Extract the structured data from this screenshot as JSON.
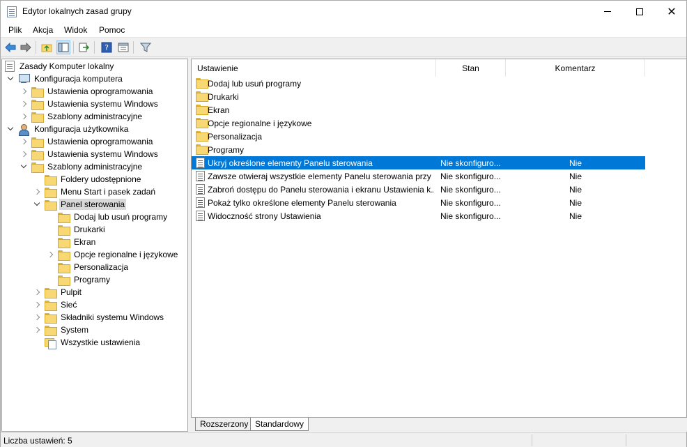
{
  "window": {
    "title": "Edytor lokalnych zasad grupy"
  },
  "menubar": {
    "items": [
      {
        "label": "Plik"
      },
      {
        "label": "Akcja"
      },
      {
        "label": "Widok"
      },
      {
        "label": "Pomoc"
      }
    ]
  },
  "toolbar": {
    "buttons": [
      "back-arrow-icon",
      "forward-arrow-icon",
      "up-folder-icon",
      "show-hide-tree-icon",
      "export-list-icon",
      "help-icon",
      "properties-icon",
      "filter-icon"
    ]
  },
  "tree": {
    "items": [
      {
        "label": "Zasady Komputer lokalny",
        "icon": "policy-doc-icon"
      },
      {
        "label": "Konfiguracja komputera",
        "icon": "computer-icon"
      },
      {
        "label": "Ustawienia oprogramowania",
        "icon": "folder-icon"
      },
      {
        "label": "Ustawienia systemu Windows",
        "icon": "folder-icon"
      },
      {
        "label": "Szablony administracyjne",
        "icon": "folder-icon"
      },
      {
        "label": "Konfiguracja użytkownika",
        "icon": "user-icon"
      },
      {
        "label": "Ustawienia oprogramowania",
        "icon": "folder-icon"
      },
      {
        "label": "Ustawienia systemu Windows",
        "icon": "folder-icon"
      },
      {
        "label": "Szablony administracyjne",
        "icon": "folder-icon"
      },
      {
        "label": "Foldery udostępnione",
        "icon": "folder-icon"
      },
      {
        "label": "Menu Start i pasek zadań",
        "icon": "folder-icon"
      },
      {
        "label": "Panel sterowania",
        "icon": "open-folder-icon"
      },
      {
        "label": "Dodaj lub usuń programy",
        "icon": "folder-icon"
      },
      {
        "label": "Drukarki",
        "icon": "folder-icon"
      },
      {
        "label": "Ekran",
        "icon": "folder-icon"
      },
      {
        "label": "Opcje regionalne i językowe",
        "icon": "folder-icon"
      },
      {
        "label": "Personalizacja",
        "icon": "folder-icon"
      },
      {
        "label": "Programy",
        "icon": "folder-icon"
      },
      {
        "label": "Pulpit",
        "icon": "folder-icon"
      },
      {
        "label": "Sieć",
        "icon": "folder-icon"
      },
      {
        "label": "Składniki systemu Windows",
        "icon": "folder-icon"
      },
      {
        "label": "System",
        "icon": "folder-icon"
      },
      {
        "label": "Wszystkie ustawienia",
        "icon": "all-settings-icon"
      }
    ]
  },
  "list": {
    "headers": {
      "setting": "Ustawienie",
      "state": "Stan",
      "comment": "Komentarz"
    },
    "folders": [
      "Dodaj lub usuń programy",
      "Drukarki",
      "Ekran",
      "Opcje regionalne i językowe",
      "Personalizacja",
      "Programy"
    ],
    "settings": [
      {
        "name": "Ukryj określone elementy Panelu sterowania",
        "state": "Nie skonfiguro...",
        "comment": "Nie"
      },
      {
        "name": "Zawsze otwieraj wszystkie elementy Panelu sterowania przy ...",
        "state": "Nie skonfiguro...",
        "comment": "Nie"
      },
      {
        "name": "Zabroń dostępu do Panelu sterowania i ekranu Ustawienia k...",
        "state": "Nie skonfiguro...",
        "comment": "Nie"
      },
      {
        "name": "Pokaż tylko określone elementy Panelu sterowania",
        "state": "Nie skonfiguro...",
        "comment": "Nie"
      },
      {
        "name": "Widoczność strony Ustawienia",
        "state": "Nie skonfiguro...",
        "comment": "Nie"
      }
    ]
  },
  "tabs": [
    {
      "label": "Rozszerzony"
    },
    {
      "label": "Standardowy"
    }
  ],
  "statusbar": {
    "text": "Liczba ustawień: 5"
  },
  "colors": {
    "selection": "#0078d7",
    "tree_selection": "#d9d9d9",
    "folder": "#f8d775"
  }
}
